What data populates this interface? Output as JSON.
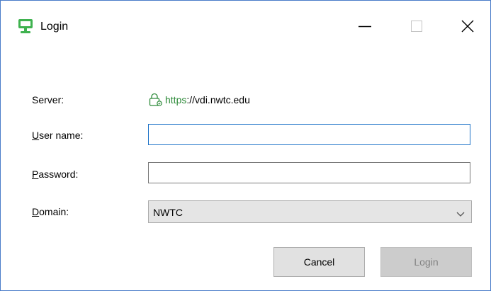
{
  "window": {
    "title": "Login"
  },
  "form": {
    "server_label": "Server:",
    "server_scheme": "https",
    "server_rest": "://vdi.nwtc.edu",
    "username_label_accesskey": "U",
    "username_label_rest": "ser name:",
    "username_value": "",
    "password_label_accesskey": "P",
    "password_label_rest": "assword:",
    "password_value": "",
    "domain_label_accesskey": "D",
    "domain_label_rest": "omain:",
    "domain_selected": "NWTC"
  },
  "buttons": {
    "cancel_label": "Cancel",
    "login_label": "Login",
    "login_enabled": false
  },
  "icons": {
    "app": "monitor-icon",
    "minimize": "minimize-icon",
    "maximize": "maximize-icon",
    "close": "close-icon",
    "secure": "lock-icon",
    "dropdown": "chevron-down-icon"
  },
  "colors": {
    "accent": "#2e8b3a",
    "focus": "#1e73c8",
    "window_border": "#4a7cc9"
  }
}
